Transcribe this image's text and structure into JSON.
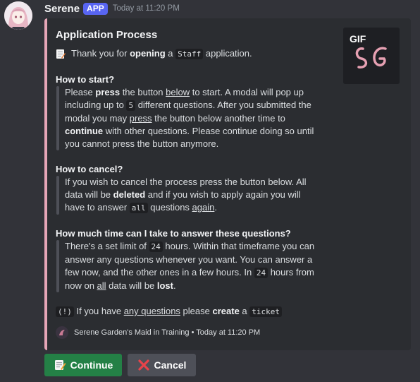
{
  "message": {
    "author": "Serene",
    "badge": "APP",
    "timestamp": "Today at 11:20 PM"
  },
  "embed": {
    "title": "Application Process",
    "accent_color": "#e6a6b7",
    "thumbnail_label": "GIF",
    "intro": {
      "t1": "Thank you for ",
      "b1": "opening",
      "t2": " a ",
      "code1": "Staff",
      "t3": " application."
    },
    "start": {
      "title": "How to start?",
      "l1a": "Please ",
      "l1b": "press",
      "l1c": " the button ",
      "l1d": "below",
      "l1e": " to start. A modal will pop up",
      "l2a": "including up to ",
      "l2code": "5",
      "l2b": " different questions. After you submitted the",
      "l3a": "modal you may ",
      "l3b": "press",
      "l3c": " the button below another time to",
      "l4a": "continue",
      "l4b": " with other questions. Please continue doing so until",
      "l5": "you cannot press the button anymore."
    },
    "cancel": {
      "title": "How to cancel?",
      "l1": "If you wish to cancel the process press the button below. All",
      "l2a": "data will be ",
      "l2b": "deleted",
      "l2c": " and if you wish to apply again you will",
      "l3a": "have to answer ",
      "l3code": "all",
      "l3b": " questions ",
      "l3c": "again",
      "l3d": "."
    },
    "time": {
      "title": "How much time can I take to answer these questions?",
      "l1a": "There's a set limit of ",
      "l1code": "24",
      "l1b": " hours. Within that timeframe you can",
      "l2": "answer any questions whenever you want. You can answer a",
      "l3a": "few now, and the other ones in a few hours. In ",
      "l3code": "24",
      "l3b": " hours from",
      "l4a": "now on ",
      "l4b": "all",
      "l4c": " data will be ",
      "l4d": "lost",
      "l4e": "."
    },
    "final": {
      "code1": "(!)",
      "t1": " If you have ",
      "u1": "any questions",
      "t2": " please ",
      "b1": "create",
      "t3": " a ",
      "code2": "ticket"
    },
    "footer": "Serene Garden's Maid in Training • Today at 11:20 PM"
  },
  "buttons": {
    "continue": "Continue",
    "cancel": "Cancel"
  }
}
